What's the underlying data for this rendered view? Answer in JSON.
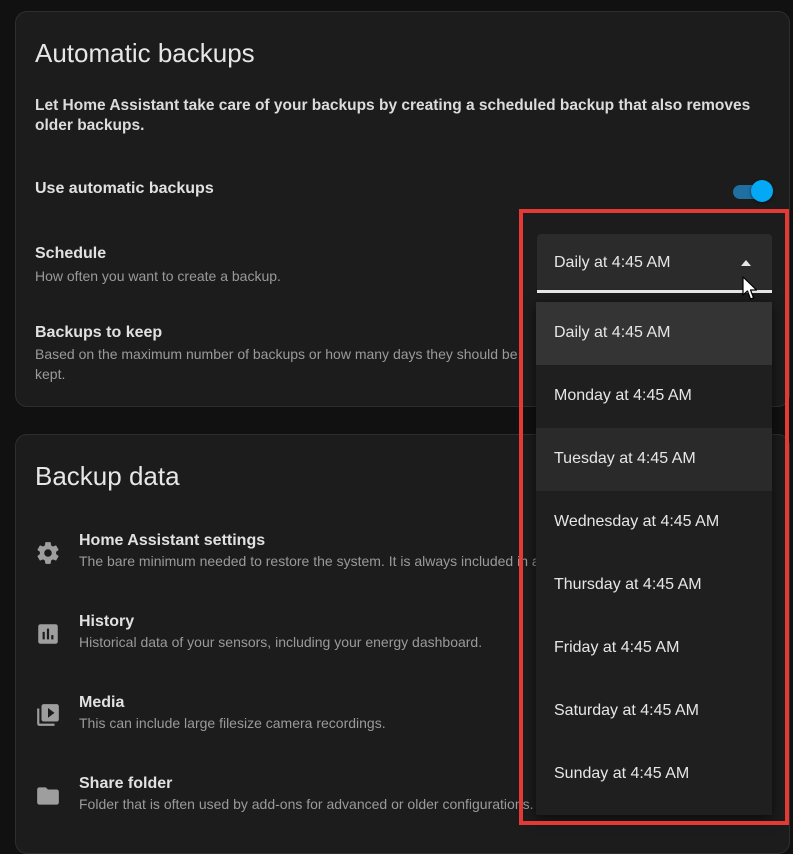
{
  "automatic": {
    "title": "Automatic backups",
    "intro": "Let Home Assistant take care of your backups by creating a scheduled backup that also removes older backups.",
    "use_label": "Use automatic backups",
    "use_enabled": true,
    "schedule_label": "Schedule",
    "schedule_sub": "How often you want to create a backup.",
    "keep_label": "Backups to keep",
    "keep_sub": "Based on the maximum number of backups or how many days they should be kept."
  },
  "schedule_select": {
    "value": "Daily at 4:45 AM",
    "options": [
      "Daily at 4:45 AM",
      "Monday at 4:45 AM",
      "Tuesday at 4:45 AM",
      "Wednesday at 4:45 AM",
      "Thursday at 4:45 AM",
      "Friday at 4:45 AM",
      "Saturday at 4:45 AM",
      "Sunday at 4:45 AM"
    ],
    "selected_index": 0,
    "hover_index": 2
  },
  "backup_data": {
    "title": "Backup data",
    "items": [
      {
        "label": "Home Assistant settings",
        "sub": "The bare minimum needed to restore the system. It is always included in au",
        "icon": "gear-icon"
      },
      {
        "label": "History",
        "sub": "Historical data of your sensors, including your energy dashboard.",
        "icon": "chart-box-icon"
      },
      {
        "label": "Media",
        "sub": "This can include large filesize camera recordings.",
        "icon": "play-box-multiple-icon"
      },
      {
        "label": "Share folder",
        "sub": "Folder that is often used by add-ons for advanced or older configurations.",
        "icon": "folder-icon"
      }
    ]
  },
  "colors": {
    "accent": "#03a9f4",
    "highlight": "#e53935"
  }
}
